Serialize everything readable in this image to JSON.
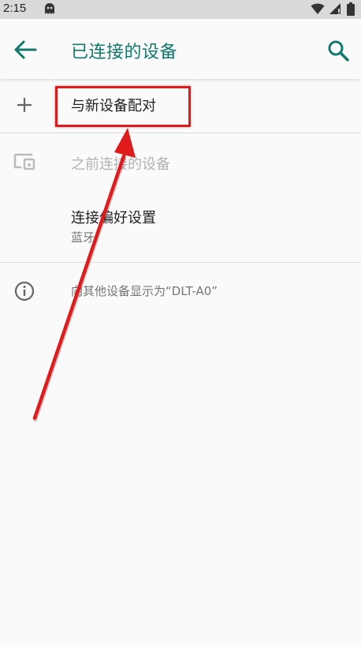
{
  "status_bar": {
    "time": "2:15",
    "icons": [
      "ghost-icon",
      "wifi-icon",
      "signal-icon",
      "battery-icon"
    ]
  },
  "toolbar": {
    "title": "已连接的设备",
    "back_icon": "arrow-left-icon",
    "search_icon": "search-icon",
    "accent_color": "#11796b"
  },
  "list": {
    "pair_new": {
      "label": "与新设备配对",
      "icon": "plus-icon"
    },
    "previous_devices": {
      "label": "之前连接的设备",
      "icon": "devices-icon"
    },
    "connection_prefs": {
      "label": "连接偏好设置",
      "summary": "蓝牙"
    },
    "visibility_info": {
      "text": "向其他设备显示为“DLT-A0”",
      "icon": "info-icon"
    }
  },
  "annotation": {
    "highlight_color": "#e01b1b"
  }
}
